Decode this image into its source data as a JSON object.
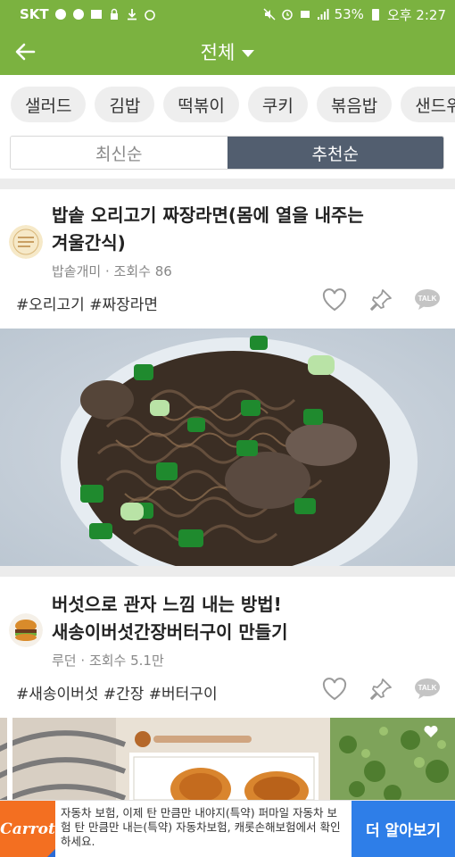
{
  "status": {
    "carrier": "SKT",
    "battery": "53%",
    "time": "오후 2:27"
  },
  "app_bar": {
    "title": "전체"
  },
  "categories": [
    "샐러드",
    "김밥",
    "떡볶이",
    "쿠키",
    "볶음밥",
    "샌드위"
  ],
  "sort": {
    "latest": "최신순",
    "recommended": "추천순",
    "selected": "추천순"
  },
  "posts": [
    {
      "title_line1": "밥솥 오리고기 짜장라면(몸에 열을 내주는",
      "title_line2": "겨울간식)",
      "author": "밥솥개미",
      "views": "조회수 86",
      "tags": "#오리고기 #짜장라면"
    },
    {
      "title_line1": "버섯으로 관자 느낌 내는 방법!",
      "title_line2": "새송이버섯간장버터구이 만들기",
      "author": "루던",
      "views": "조회수 5.1만",
      "tags": "#새송이버섯 #간장 #버터구이"
    }
  ],
  "ad": {
    "brand": "Carrot",
    "text": "자동차 보험, 이제 탄 만큼만 내야지(특약) 퍼마일 자동차 보험 탄 만큼만 내는(특약) 자동차보험, 캐롯손해보험에서 확인하세요.",
    "cta": "더 알아보기"
  },
  "colors": {
    "brand_green": "#7bb240",
    "sort_active": "#525e6f",
    "ad_orange": "#f36f21",
    "ad_blue": "#2e7ee8"
  }
}
